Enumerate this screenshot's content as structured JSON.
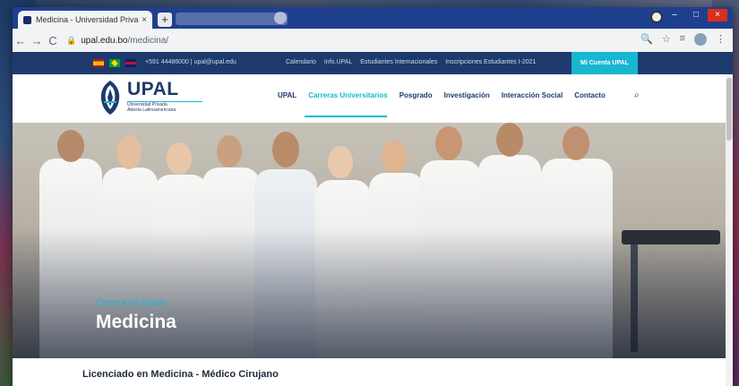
{
  "browser": {
    "tab_title": "Medicina - Universidad Privada",
    "tab_close": "×",
    "new_tab": "+",
    "address": {
      "host": "upal.edu.bo",
      "path": "/medicina/"
    },
    "nav": {
      "back": "←",
      "forward": "→",
      "reload": "C",
      "lock": "🔒"
    },
    "right_icons": {
      "search": "🔍",
      "star": "☆",
      "media": "≡",
      "menu": "⋮"
    },
    "window_controls": {
      "minimize": "–",
      "maximize": "□",
      "close": "×"
    }
  },
  "topbar": {
    "flags": [
      "es",
      "br",
      "uk"
    ],
    "contact": "+591 44486000 | upal@upal.edu",
    "links": [
      "Calendario",
      "Info.UPAL",
      "Estudiantes Internacionales",
      "Inscripciones Estudiantes I-2021"
    ],
    "account_button": "Mi Cuenta UPAL"
  },
  "header": {
    "logo_title": "UPAL",
    "logo_sub1": "Universidad Privada",
    "logo_sub2": "Abierta Latinoamericana",
    "nav": [
      {
        "label": "UPAL",
        "active": false
      },
      {
        "label": "Carreras Universitarios",
        "active": true
      },
      {
        "label": "Posgrado",
        "active": false
      },
      {
        "label": "Investigación",
        "active": false
      },
      {
        "label": "Interacción Social",
        "active": false
      },
      {
        "label": "Contacto",
        "active": false
      }
    ],
    "search_icon": "⌕"
  },
  "hero": {
    "kicker": "Carrera de Grado",
    "title": "Medicina"
  },
  "content": {
    "subtitle": "Licenciado en Medicina - Médico Cirujano"
  },
  "colors": {
    "navy": "#1e3a6d",
    "accent": "#17b7d1",
    "chrome_tabstrip": "#1f3f8f"
  }
}
